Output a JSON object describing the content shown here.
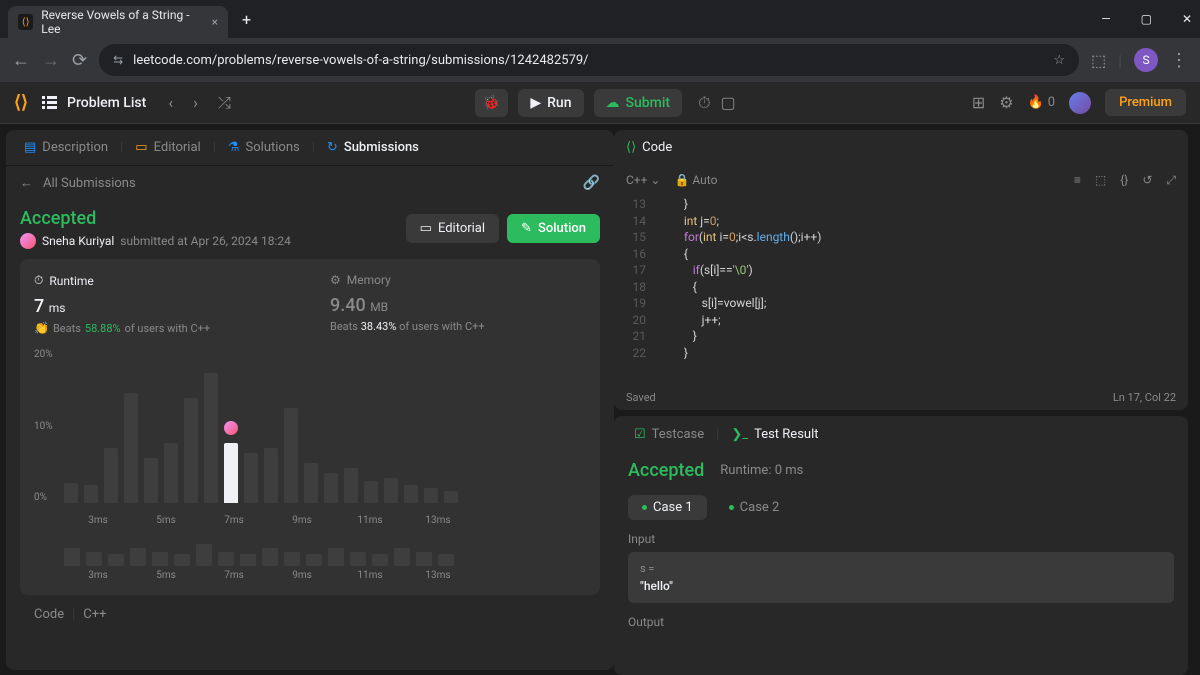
{
  "browser": {
    "tab_title": "Reverse Vowels of a String - Lee",
    "url": "leetcode.com/problems/reverse-vowels-of-a-string/submissions/1242482579/",
    "profile_letter": "S"
  },
  "toolbar": {
    "problem_list": "Problem List",
    "run": "Run",
    "submit": "Submit",
    "streak": "0",
    "premium": "Premium"
  },
  "left_tabs": {
    "description": "Description",
    "editorial": "Editorial",
    "solutions": "Solutions",
    "submissions": "Submissions"
  },
  "sub_header": {
    "all": "All Submissions"
  },
  "result": {
    "status": "Accepted",
    "author": "Sneha Kuriyal",
    "submitted": "submitted at Apr 26, 2024 18:24",
    "editorial_btn": "Editorial",
    "solution_btn": "Solution"
  },
  "stats": {
    "runtime_label": "Runtime",
    "runtime_val": "7",
    "runtime_unit": "ms",
    "runtime_beats_pct": "58.88%",
    "runtime_beats_suffix": "of users with C++",
    "memory_label": "Memory",
    "memory_val": "9.40",
    "memory_unit": "MB",
    "memory_beats_pct": "38.43%",
    "memory_beats_suffix": "of users with C++",
    "beats_word": "Beats"
  },
  "chart_data": {
    "type": "bar",
    "ylabels": [
      "20%",
      "10%",
      "0%"
    ],
    "xlabels": [
      "3ms",
      "5ms",
      "7ms",
      "9ms",
      "11ms",
      "13ms"
    ],
    "bars": [
      20,
      18,
      55,
      110,
      45,
      60,
      105,
      130,
      60,
      50,
      55,
      95,
      40,
      30,
      35,
      22,
      25,
      18,
      15,
      12
    ],
    "highlight_index": 8,
    "mini_bars": [
      18,
      14,
      12,
      18,
      14,
      12,
      22,
      14,
      12,
      18,
      14,
      12,
      18,
      14,
      12,
      18,
      14,
      12
    ],
    "mini_xlabels": [
      "3ms",
      "5ms",
      "7ms",
      "9ms",
      "11ms",
      "13ms"
    ]
  },
  "code_footer": {
    "code": "Code",
    "lang": "C++"
  },
  "code": {
    "header": "Code",
    "lang": "C++",
    "auto": "Auto",
    "status_saved": "Saved",
    "status_pos": "Ln 17, Col 22",
    "lines": [
      13,
      14,
      15,
      16,
      17,
      18,
      19,
      20,
      21,
      22
    ]
  },
  "testresult": {
    "testcase_tab": "Testcase",
    "result_tab": "Test Result",
    "status": "Accepted",
    "runtime": "Runtime: 0 ms",
    "case1": "Case 1",
    "case2": "Case 2",
    "input_label": "Input",
    "input_var": "s =",
    "input_val": "\"hello\"",
    "output_label": "Output"
  }
}
